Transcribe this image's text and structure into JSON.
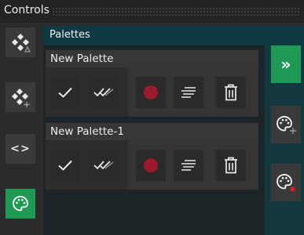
{
  "window": {
    "title": "Controls"
  },
  "header": {
    "label": "Palettes"
  },
  "palettes": [
    {
      "name": "New Palette"
    },
    {
      "name": "New Palette-1"
    }
  ],
  "rail": {
    "code_glyph": "<>"
  },
  "side": {
    "expand_glyph": "»"
  },
  "colors": {
    "accent_green": "#1f9a54",
    "record_red": "#9b1a2b",
    "teal_band": "#0f3a44"
  },
  "icons": {
    "rail": [
      "move-triangle-icon",
      "move-add-icon",
      "code-brackets-icon",
      "palette-icon"
    ],
    "palette_row": [
      "check-icon",
      "double-check-icon",
      "record-icon",
      "align-lines-icon",
      "trash-icon"
    ],
    "side": [
      "expand-chevron-icon",
      "palette-add-icon",
      "palette-dot-icon"
    ]
  }
}
